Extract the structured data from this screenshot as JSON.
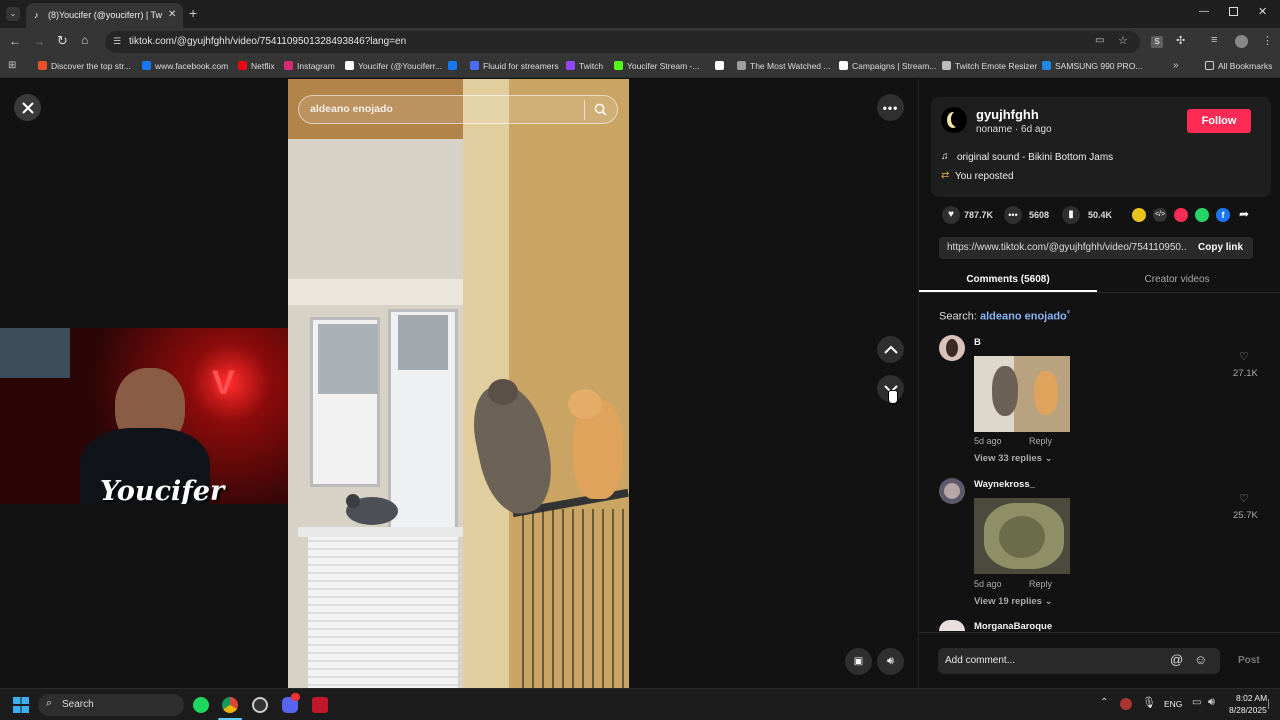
{
  "browser": {
    "tab_title": "(8)Youcifer (@youciferr) | Tw",
    "url": "tiktok.com/@gyujhfghh/video/7541109501328493846?lang=en",
    "bookmarks": [
      {
        "label": "Discover the top str...",
        "color": "#e8512b"
      },
      {
        "label": "www.facebook.com",
        "color": "#1877f2"
      },
      {
        "label": "Netflix",
        "color": "#e50914"
      },
      {
        "label": "Instagram",
        "color": "#d62976"
      },
      {
        "label": "Youcifer (@Youciferr...",
        "color": "#ffffff"
      },
      {
        "label": "",
        "color": "#1877f2"
      },
      {
        "label": "Fluuid for streamers",
        "color": "#4a6cf7"
      },
      {
        "label": "Twitch",
        "color": "#9146ff"
      },
      {
        "label": "Youcifer Stream -...",
        "color": "#53fc18"
      },
      {
        "label": "",
        "color": "#ffffff"
      },
      {
        "label": "The Most Watched ...",
        "color": "#9e9e9e"
      },
      {
        "label": "Campaigns | Stream...",
        "color": "#ffffff"
      },
      {
        "label": "Twitch Emote Resizer",
        "color": "#bdbdbd"
      },
      {
        "label": "SAMSUNG 990 PRO...",
        "color": "#1e88e5"
      }
    ],
    "all_bookmarks": "All Bookmarks"
  },
  "video": {
    "search_text": "aldeano enojado",
    "streamer_logo": "Youcifer"
  },
  "author": {
    "username": "gyujhfghh",
    "subtitle": "noname · 6d ago",
    "follow_label": "Follow",
    "sound": "original sound - Bikini Bottom Jams",
    "reposted": "You reposted"
  },
  "stats": {
    "likes": "787.7K",
    "comments": "5608",
    "saves": "50.4K"
  },
  "share": {
    "link": "https://www.tiktok.com/@gyujhfghh/video/754110950...",
    "copy_label": "Copy link"
  },
  "tabs": {
    "comments": "Comments (5608)",
    "creator": "Creator videos"
  },
  "search": {
    "prefix": "Search:",
    "term": "aldeano enojado"
  },
  "comments": [
    {
      "user": "B",
      "age": "5d ago",
      "reply": "Reply",
      "replies": "View 33 replies",
      "likes": "27.1K"
    },
    {
      "user": "Waynekross_",
      "age": "5d ago",
      "reply": "Reply",
      "replies": "View 19 replies",
      "likes": "25.7K"
    },
    {
      "user": "MorganaBaroque"
    }
  ],
  "composer": {
    "placeholder": "Add comment...",
    "post_label": "Post"
  },
  "taskbar": {
    "search_label": "Search",
    "lang": "ENG",
    "time": "8:02 AM",
    "date": "8/28/2025"
  },
  "colors": {
    "accent": "#fe2c55",
    "link": "#8ab4f8"
  }
}
